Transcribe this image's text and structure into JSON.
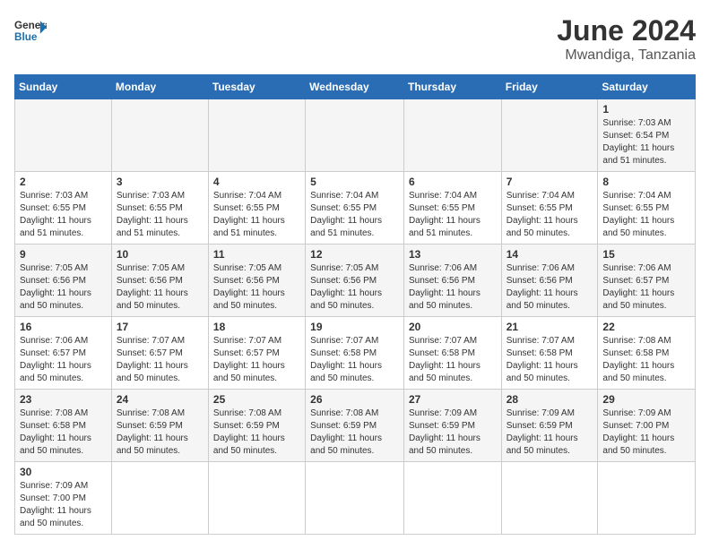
{
  "header": {
    "logo_general": "General",
    "logo_blue": "Blue",
    "month_year": "June 2024",
    "location": "Mwandiga, Tanzania"
  },
  "weekdays": [
    "Sunday",
    "Monday",
    "Tuesday",
    "Wednesday",
    "Thursday",
    "Friday",
    "Saturday"
  ],
  "weeks": [
    [
      {
        "day": "",
        "info": ""
      },
      {
        "day": "",
        "info": ""
      },
      {
        "day": "",
        "info": ""
      },
      {
        "day": "",
        "info": ""
      },
      {
        "day": "",
        "info": ""
      },
      {
        "day": "",
        "info": ""
      },
      {
        "day": "1",
        "info": "Sunrise: 7:03 AM\nSunset: 6:54 PM\nDaylight: 11 hours and 51 minutes."
      }
    ],
    [
      {
        "day": "2",
        "info": "Sunrise: 7:03 AM\nSunset: 6:55 PM\nDaylight: 11 hours and 51 minutes."
      },
      {
        "day": "3",
        "info": "Sunrise: 7:03 AM\nSunset: 6:55 PM\nDaylight: 11 hours and 51 minutes."
      },
      {
        "day": "4",
        "info": "Sunrise: 7:04 AM\nSunset: 6:55 PM\nDaylight: 11 hours and 51 minutes."
      },
      {
        "day": "5",
        "info": "Sunrise: 7:04 AM\nSunset: 6:55 PM\nDaylight: 11 hours and 51 minutes."
      },
      {
        "day": "6",
        "info": "Sunrise: 7:04 AM\nSunset: 6:55 PM\nDaylight: 11 hours and 51 minutes."
      },
      {
        "day": "7",
        "info": "Sunrise: 7:04 AM\nSunset: 6:55 PM\nDaylight: 11 hours and 50 minutes."
      },
      {
        "day": "8",
        "info": "Sunrise: 7:04 AM\nSunset: 6:55 PM\nDaylight: 11 hours and 50 minutes."
      }
    ],
    [
      {
        "day": "9",
        "info": "Sunrise: 7:05 AM\nSunset: 6:56 PM\nDaylight: 11 hours and 50 minutes."
      },
      {
        "day": "10",
        "info": "Sunrise: 7:05 AM\nSunset: 6:56 PM\nDaylight: 11 hours and 50 minutes."
      },
      {
        "day": "11",
        "info": "Sunrise: 7:05 AM\nSunset: 6:56 PM\nDaylight: 11 hours and 50 minutes."
      },
      {
        "day": "12",
        "info": "Sunrise: 7:05 AM\nSunset: 6:56 PM\nDaylight: 11 hours and 50 minutes."
      },
      {
        "day": "13",
        "info": "Sunrise: 7:06 AM\nSunset: 6:56 PM\nDaylight: 11 hours and 50 minutes."
      },
      {
        "day": "14",
        "info": "Sunrise: 7:06 AM\nSunset: 6:56 PM\nDaylight: 11 hours and 50 minutes."
      },
      {
        "day": "15",
        "info": "Sunrise: 7:06 AM\nSunset: 6:57 PM\nDaylight: 11 hours and 50 minutes."
      }
    ],
    [
      {
        "day": "16",
        "info": "Sunrise: 7:06 AM\nSunset: 6:57 PM\nDaylight: 11 hours and 50 minutes."
      },
      {
        "day": "17",
        "info": "Sunrise: 7:07 AM\nSunset: 6:57 PM\nDaylight: 11 hours and 50 minutes."
      },
      {
        "day": "18",
        "info": "Sunrise: 7:07 AM\nSunset: 6:57 PM\nDaylight: 11 hours and 50 minutes."
      },
      {
        "day": "19",
        "info": "Sunrise: 7:07 AM\nSunset: 6:58 PM\nDaylight: 11 hours and 50 minutes."
      },
      {
        "day": "20",
        "info": "Sunrise: 7:07 AM\nSunset: 6:58 PM\nDaylight: 11 hours and 50 minutes."
      },
      {
        "day": "21",
        "info": "Sunrise: 7:07 AM\nSunset: 6:58 PM\nDaylight: 11 hours and 50 minutes."
      },
      {
        "day": "22",
        "info": "Sunrise: 7:08 AM\nSunset: 6:58 PM\nDaylight: 11 hours and 50 minutes."
      }
    ],
    [
      {
        "day": "23",
        "info": "Sunrise: 7:08 AM\nSunset: 6:58 PM\nDaylight: 11 hours and 50 minutes."
      },
      {
        "day": "24",
        "info": "Sunrise: 7:08 AM\nSunset: 6:59 PM\nDaylight: 11 hours and 50 minutes."
      },
      {
        "day": "25",
        "info": "Sunrise: 7:08 AM\nSunset: 6:59 PM\nDaylight: 11 hours and 50 minutes."
      },
      {
        "day": "26",
        "info": "Sunrise: 7:08 AM\nSunset: 6:59 PM\nDaylight: 11 hours and 50 minutes."
      },
      {
        "day": "27",
        "info": "Sunrise: 7:09 AM\nSunset: 6:59 PM\nDaylight: 11 hours and 50 minutes."
      },
      {
        "day": "28",
        "info": "Sunrise: 7:09 AM\nSunset: 6:59 PM\nDaylight: 11 hours and 50 minutes."
      },
      {
        "day": "29",
        "info": "Sunrise: 7:09 AM\nSunset: 7:00 PM\nDaylight: 11 hours and 50 minutes."
      }
    ],
    [
      {
        "day": "30",
        "info": "Sunrise: 7:09 AM\nSunset: 7:00 PM\nDaylight: 11 hours and 50 minutes."
      },
      {
        "day": "",
        "info": ""
      },
      {
        "day": "",
        "info": ""
      },
      {
        "day": "",
        "info": ""
      },
      {
        "day": "",
        "info": ""
      },
      {
        "day": "",
        "info": ""
      },
      {
        "day": "",
        "info": ""
      }
    ]
  ]
}
